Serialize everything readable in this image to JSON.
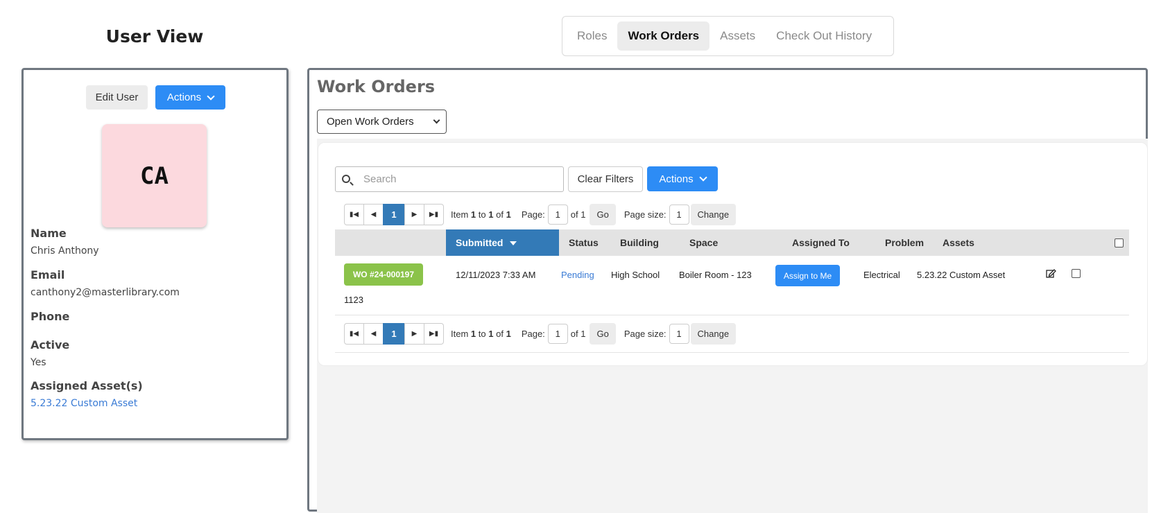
{
  "page": {
    "title": "User View"
  },
  "tabs": [
    {
      "label": "Roles",
      "active": false
    },
    {
      "label": "Work Orders",
      "active": true
    },
    {
      "label": "Assets",
      "active": false
    },
    {
      "label": "Check Out History",
      "active": false
    }
  ],
  "user": {
    "edit_label": "Edit User",
    "actions_label": "Actions",
    "initials": "CA",
    "avatar_color": "#fcd9de",
    "fields": {
      "name_label": "Name",
      "name_value": "Chris Anthony",
      "email_label": "Email",
      "email_value": "canthony2@masterlibrary.com",
      "phone_label": "Phone",
      "phone_value": "",
      "active_label": "Active",
      "active_value": "Yes",
      "assets_label": "Assigned Asset(s)",
      "assets_value": "5.23.22 Custom Asset"
    }
  },
  "work_orders": {
    "title": "Work Orders",
    "filter_selected": "Open Work Orders",
    "search_placeholder": "Search",
    "clear_filters_label": "Clear Filters",
    "actions_label": "Actions",
    "pager": {
      "current_page": "1",
      "item_prefix": "Item",
      "item_from": "1",
      "item_to_word": "to",
      "item_to": "1",
      "item_of_word": "of",
      "item_total": "1",
      "page_label": "Page:",
      "page_value": "1",
      "page_of": "of 1",
      "go_label": "Go",
      "page_size_label": "Page size:",
      "page_size_value": "1",
      "change_label": "Change"
    },
    "columns": {
      "submitted": "Submitted",
      "status": "Status",
      "building": "Building",
      "space": "Space",
      "assigned_to": "Assigned To",
      "problem": "Problem",
      "assets": "Assets"
    },
    "rows": [
      {
        "wo_number": "WO #24-000197",
        "submitted": "12/11/2023 7:33 AM",
        "status": "Pending",
        "building": "High School",
        "space": "Boiler Room - 123",
        "assign_label": "Assign to Me",
        "problem": "Electrical",
        "assets": "5.23.22 Custom Asset",
        "sub_text": "1123"
      }
    ],
    "colors": {
      "primary": "#2d8cf5",
      "header_sorted": "#337ab7",
      "wo_badge": "#8bc34a"
    }
  }
}
